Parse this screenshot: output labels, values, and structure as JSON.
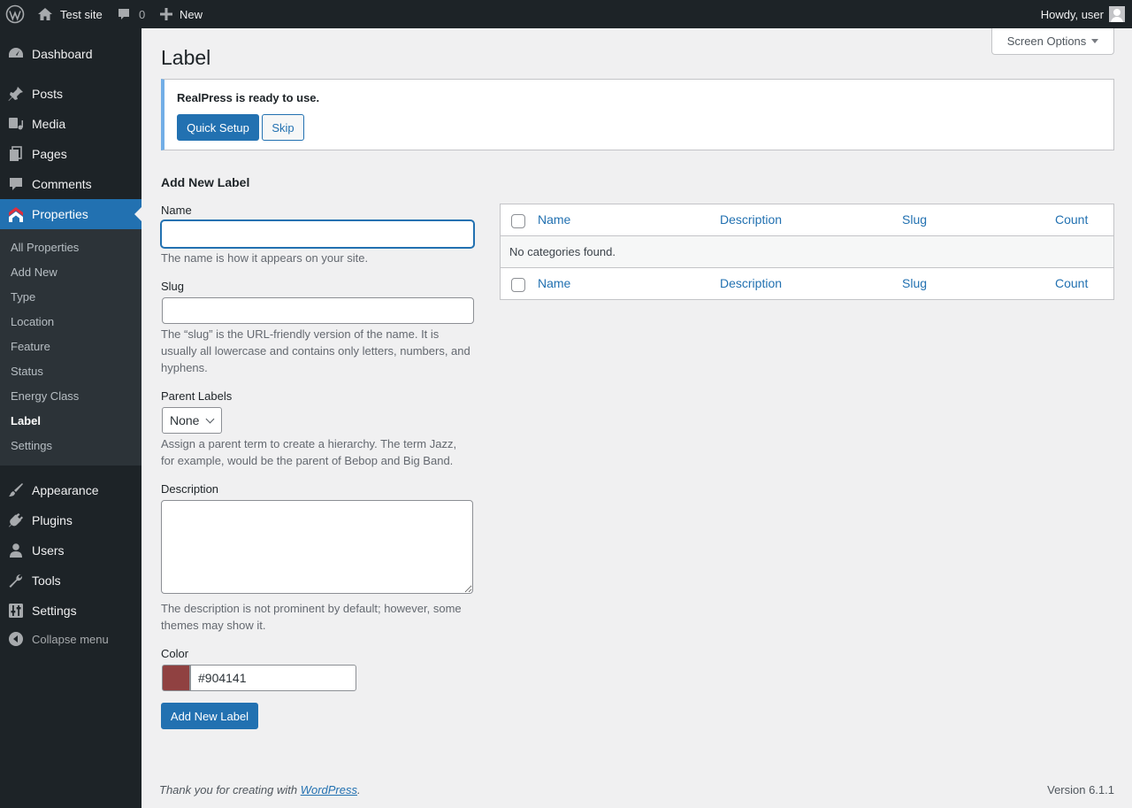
{
  "adminbar": {
    "site_name": "Test site",
    "comments_count": "0",
    "new_label": "New",
    "howdy": "Howdy, user"
  },
  "menu": {
    "dashboard": "Dashboard",
    "posts": "Posts",
    "media": "Media",
    "pages": "Pages",
    "comments": "Comments",
    "properties": "Properties",
    "appearance": "Appearance",
    "plugins": "Plugins",
    "users": "Users",
    "tools": "Tools",
    "settings": "Settings",
    "collapse": "Collapse menu"
  },
  "submenu": [
    "All Properties",
    "Add New",
    "Type",
    "Location",
    "Feature",
    "Status",
    "Energy Class",
    "Label",
    "Settings"
  ],
  "screen_options": "Screen Options",
  "page_title": "Label",
  "notice": {
    "text": "RealPress is ready to use.",
    "quick_setup": "Quick Setup",
    "skip": "Skip"
  },
  "form": {
    "heading": "Add New Label",
    "name_label": "Name",
    "name_value": "",
    "name_help": "The name is how it appears on your site.",
    "slug_label": "Slug",
    "slug_value": "",
    "slug_help": "The “slug” is the URL-friendly version of the name. It is usually all lowercase and contains only letters, numbers, and hyphens.",
    "parent_label": "Parent Labels",
    "parent_value": "None",
    "parent_help": "Assign a parent term to create a hierarchy. The term Jazz, for example, would be the parent of Bebop and Big Band.",
    "description_label": "Description",
    "description_value": "",
    "description_help": "The description is not prominent by default; however, some themes may show it.",
    "color_label": "Color",
    "color_value": "#904141",
    "submit": "Add New Label"
  },
  "table": {
    "columns": [
      "Name",
      "Description",
      "Slug",
      "Count"
    ],
    "empty_message": "No categories found."
  },
  "footer": {
    "thanks_prefix": "Thank you for creating with ",
    "wordpress_link": "WordPress",
    "thanks_suffix": ".",
    "version": "Version 6.1.1"
  },
  "colors": {
    "accent": "#2271b1",
    "label_color": "#904141",
    "admin_bar": "#1d2327"
  }
}
